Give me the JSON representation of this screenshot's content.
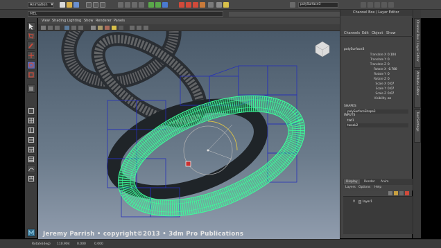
{
  "menubar": {
    "mode": "Animation",
    "search_value": "polySurface3",
    "colors": {
      "icon_red": "#d04a3a",
      "icon_green": "#5aa84a",
      "icon_blue": "#4a7ad0",
      "icon_yellow": "#d8c04a"
    }
  },
  "shelf": {
    "mel_label": "MEL"
  },
  "viewport": {
    "menus": [
      "View",
      "Shading",
      "Lighting",
      "Show",
      "Renderer",
      "Panels"
    ],
    "watermark": "Jeremy Parrish • copyright©2013 • 3dm Pro Publications",
    "wire_color": "#3cff9a"
  },
  "channel_box": {
    "title": "Channel Box / Layer Editor",
    "menus": [
      "Channels",
      "Edit",
      "Object",
      "Show"
    ],
    "object_name": "polySurface3",
    "attributes": [
      {
        "label": "Translate X",
        "value": "0.104"
      },
      {
        "label": "Translate Y",
        "value": "0"
      },
      {
        "label": "Translate Z",
        "value": "0"
      },
      {
        "label": "Rotate X",
        "value": "-0.780"
      },
      {
        "label": "Rotate Y",
        "value": "0"
      },
      {
        "label": "Rotate Z",
        "value": "0"
      },
      {
        "label": "Scale X",
        "value": "0.07"
      },
      {
        "label": "Scale Y",
        "value": "0.07"
      },
      {
        "label": "Scale Z",
        "value": "0.07"
      },
      {
        "label": "Visibility",
        "value": "on"
      }
    ],
    "shapes_header": "SHAPES",
    "shapes": [
      "polySurfaceShape3"
    ],
    "inputs_header": "INPUTS",
    "inputs": [
      "tlat1",
      "tweak2"
    ]
  },
  "layer_editor": {
    "tabs": [
      "Display",
      "Render",
      "Anim"
    ],
    "menus": [
      "Layers",
      "Options",
      "Help"
    ],
    "layer_vis": "V",
    "layer_name": "layer1"
  },
  "side_tabs": [
    "Channel Box / Layer Editor",
    "Attribute Editor",
    "Tool Settings"
  ],
  "status": {
    "label": "Rotate(deg)",
    "values": [
      "110.904",
      "0.000",
      "0.000"
    ]
  }
}
